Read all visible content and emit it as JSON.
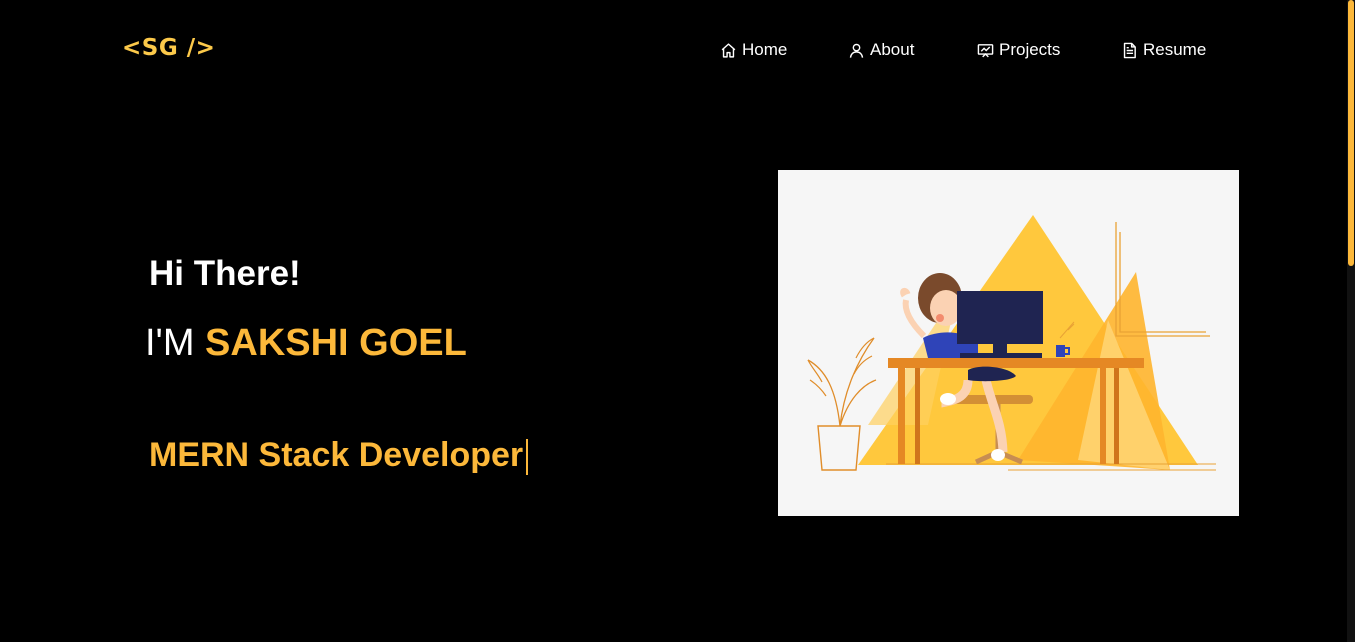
{
  "header": {
    "logo": "<SG />",
    "nav": [
      {
        "label": "Home",
        "icon": "home-icon"
      },
      {
        "label": "About",
        "icon": "user-icon"
      },
      {
        "label": "Projects",
        "icon": "projects-icon"
      },
      {
        "label": "Resume",
        "icon": "document-icon"
      }
    ]
  },
  "hero": {
    "greeting": "Hi There!",
    "intro_prefix": "I'M ",
    "name": "SAKSHI GOEL",
    "typed_role": "MERN Stack Developer"
  },
  "colors": {
    "accent": "#fcb83a",
    "logo": "#fcc94a",
    "background": "#000000",
    "illustration_bg": "#f6f6f6"
  }
}
